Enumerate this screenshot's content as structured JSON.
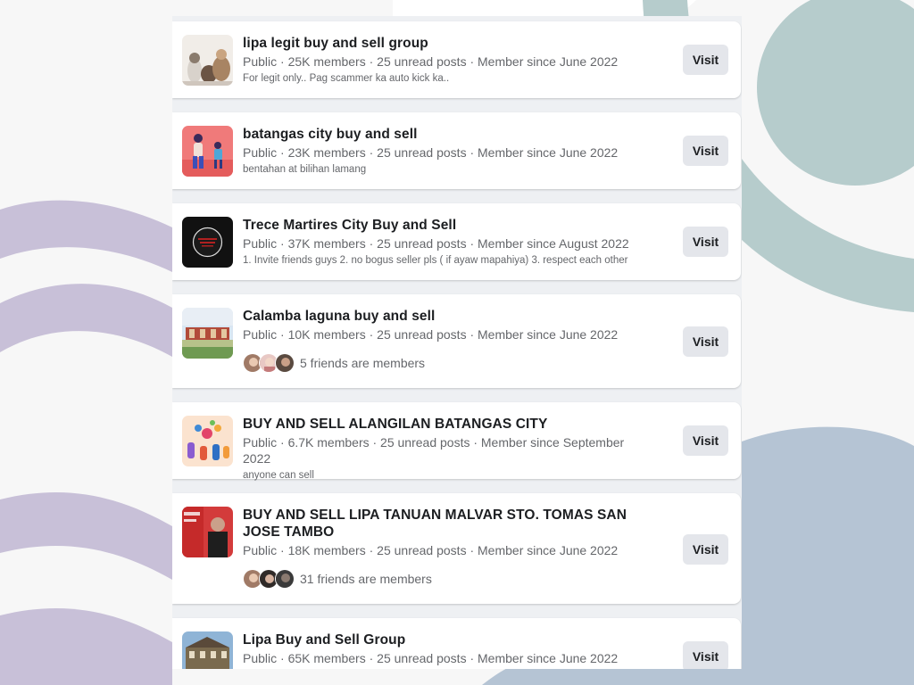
{
  "visit_label": "Visit",
  "groups": [
    {
      "name": "lipa legit buy and sell group",
      "meta": "Public · 25K members · 25 unread posts · Member since June 2022",
      "description": "For legit only.. Pag scammer ka auto kick ka..",
      "friends": ""
    },
    {
      "name": "batangas city buy and sell",
      "meta": "Public · 23K members · 25 unread posts · Member since June 2022",
      "description": "bentahan at bilihan lamang",
      "friends": ""
    },
    {
      "name": "Trece Martires City Buy and Sell",
      "meta": "Public · 37K members · 25 unread posts · Member since August 2022",
      "description": "1. Invite friends guys 2. no bogus seller pls ( if ayaw mapahiya) 3. respect each other",
      "friends": ""
    },
    {
      "name": "Calamba laguna buy and sell",
      "meta": "Public · 10K members · 25 unread posts · Member since June 2022",
      "description": "",
      "friends": "5 friends are members"
    },
    {
      "name": "BUY AND SELL ALANGILAN BATANGAS CITY",
      "meta": "Public · 6.7K members · 25 unread posts · Member since September 2022",
      "description": "anyone can sell",
      "friends": ""
    },
    {
      "name": "BUY AND SELL LIPA TANUAN MALVAR STO. TOMAS SAN JOSE TAMBO",
      "meta": "Public · 18K members · 25 unread posts · Member since June 2022",
      "description": "",
      "friends": "31 friends are members"
    },
    {
      "name": "Lipa Buy and Sell Group",
      "meta": "Public · 65K members · 25 unread posts · Member since June 2022",
      "description": "",
      "friends": ""
    }
  ],
  "colors": {
    "bg_purple": "#c8c0d8",
    "bg_teal": "#b6cccc",
    "bg_blue": "#b5c4d4",
    "bg_white": "#ffffff"
  }
}
